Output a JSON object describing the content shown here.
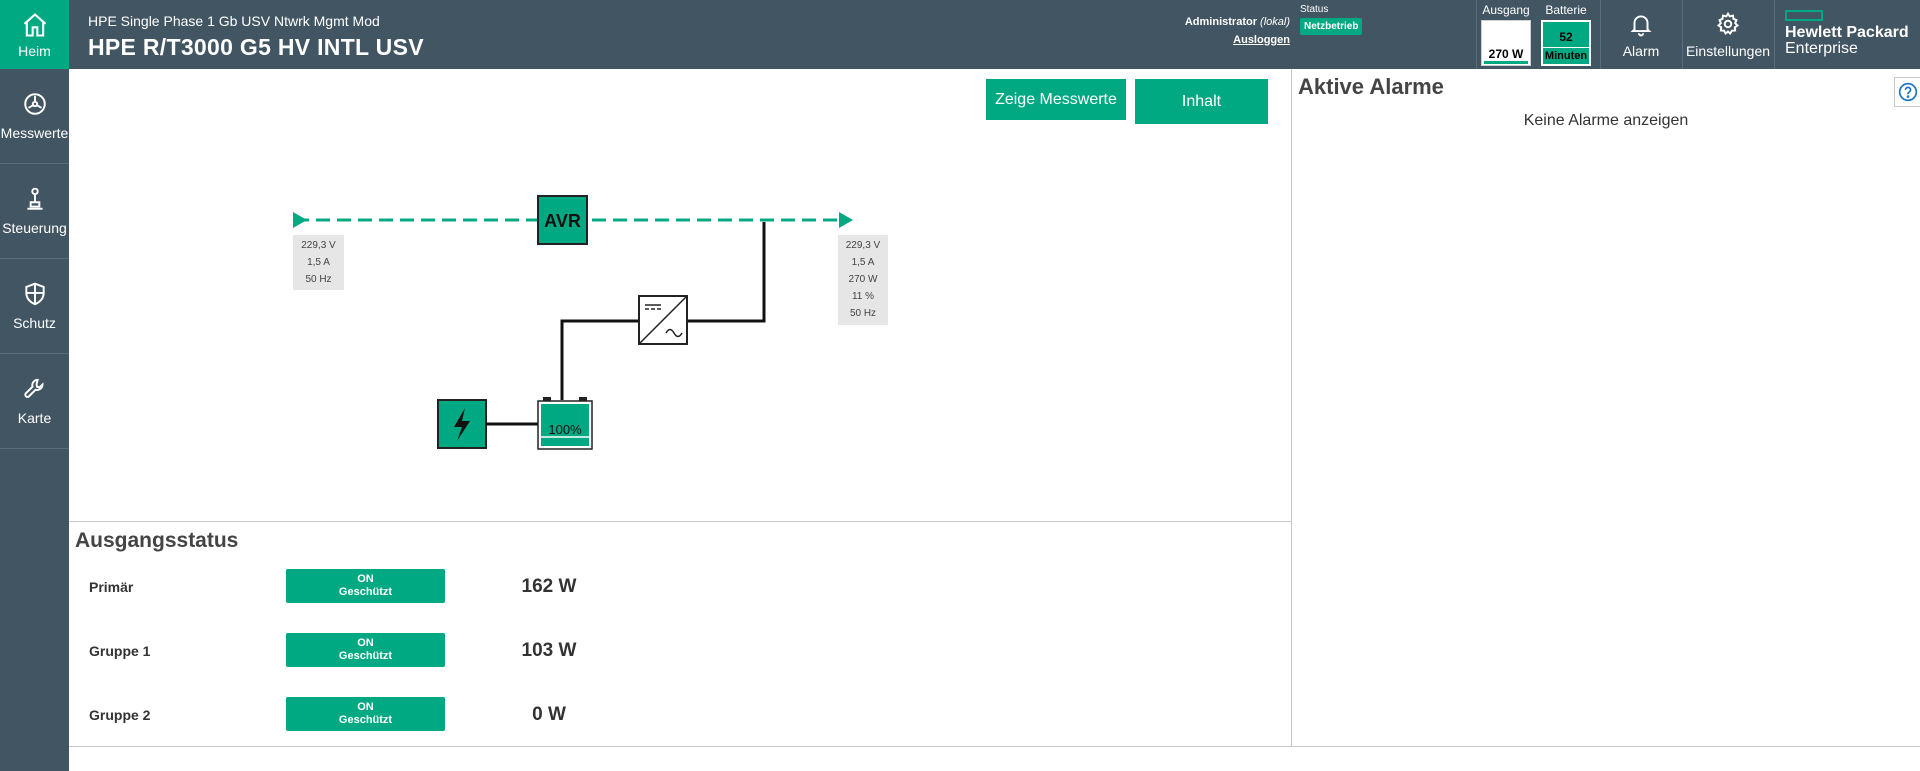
{
  "header": {
    "home_label": "Heim",
    "device_subtitle": "HPE Single Phase 1 Gb USV Ntwrk Mgmt Mod",
    "device_title": "HPE R/T3000 G5 HV INTL USV",
    "user": {
      "name": "Administrator",
      "role": "(lokal)",
      "logout": "Ausloggen"
    },
    "status": {
      "label": "Status",
      "value": "Netzbetrieb"
    },
    "output": {
      "label": "Ausgang",
      "value": "270 W"
    },
    "battery": {
      "label": "Batterie",
      "value": "52",
      "unit": "Minuten"
    },
    "alarm_label": "Alarm",
    "settings_label": "Einstellungen",
    "brand": {
      "line1": "Hewlett Packard",
      "line2": "Enterprise"
    }
  },
  "sidebar": {
    "items": [
      {
        "label": "Messwerte",
        "icon": "gauge-icon"
      },
      {
        "label": "Steuerung",
        "icon": "joystick-icon"
      },
      {
        "label": "Schutz",
        "icon": "shield-icon"
      },
      {
        "label": "Karte",
        "icon": "wrench-icon"
      }
    ]
  },
  "main": {
    "buttons": {
      "show_readings": "Zeige Messwerte",
      "content": "Inhalt"
    },
    "diagram": {
      "avr_label": "AVR",
      "battery_percent": "100%",
      "input": {
        "voltage": "229,3 V",
        "current": "1,5 A",
        "frequency": "50 Hz"
      },
      "output": {
        "voltage": "229,3 V",
        "current": "1,5 A",
        "power": "270 W",
        "load": "11 %",
        "frequency": "50 Hz"
      }
    }
  },
  "output_status": {
    "title": "Ausgangsstatus",
    "rows": [
      {
        "name": "Primär",
        "state": "ON",
        "protection": "Geschützt",
        "power": "162 W"
      },
      {
        "name": "Gruppe 1",
        "state": "ON",
        "protection": "Geschützt",
        "power": "103 W"
      },
      {
        "name": "Gruppe 2",
        "state": "ON",
        "protection": "Geschützt",
        "power": "0 W"
      }
    ]
  },
  "alarms": {
    "title": "Aktive Alarme",
    "empty_text": "Keine Alarme anzeigen"
  },
  "colors": {
    "accent": "#01a982",
    "nav": "#425563"
  }
}
